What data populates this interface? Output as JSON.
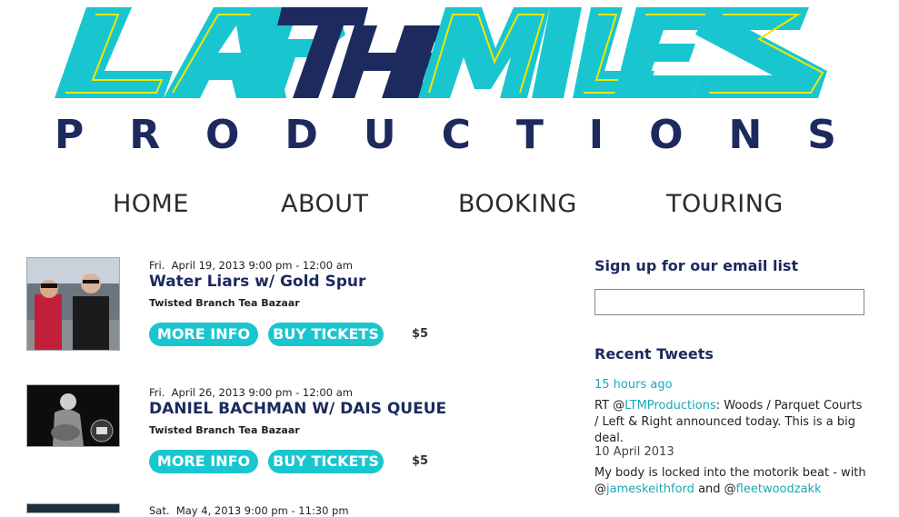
{
  "logo": {
    "art_name": "LAP THE MILES",
    "wordmark_letters": [
      "P",
      "R",
      "O",
      "D",
      "U",
      "C",
      "T",
      "I",
      "O",
      "N",
      "S"
    ]
  },
  "nav": {
    "home": "HOME",
    "about": "ABOUT",
    "booking": "BOOKING",
    "touring": "TOURING"
  },
  "events": [
    {
      "date_prefix": "Fri.",
      "date_rest": "April 19, 2013 9:00 pm - 12:00 am",
      "title": "Water Liars w/ Gold Spur",
      "venue": "Twisted Branch Tea Bazaar",
      "more_info": "MORE INFO",
      "buy": "BUY TICKETS",
      "price": "$5"
    },
    {
      "date_prefix": "Fri.",
      "date_rest": "April 26, 2013 9:00 pm - 12:00 am",
      "title": "DANIEL BACHMAN W/ DAIS QUEUE",
      "venue": "Twisted Branch Tea Bazaar",
      "more_info": "MORE INFO",
      "buy": "BUY TICKETS",
      "price": "$5"
    },
    {
      "date_prefix": "Sat.",
      "date_rest": "May 4, 2013 9:00 pm - 11:30 pm"
    }
  ],
  "sidebar": {
    "email_heading": "Sign up for our email list",
    "email_value": "",
    "tweets_heading": "Recent Tweets",
    "tweets": [
      {
        "time": "15 hours ago",
        "prefix": "RT @",
        "mention": "LTMProductions",
        "text": ": Woods / Parquet Courts / Left & Right announced today. This is a big deal."
      },
      {
        "time": "10 April 2013",
        "text_a": "My body is locked into the motorik beat - with @",
        "mention_a": "jameskeithford",
        "text_b": " and @",
        "mention_b": "fleetwoodzakk"
      }
    ]
  },
  "colors": {
    "teal": "#19c6cf",
    "navy": "#1c2a5e",
    "yellow": "#f2e600",
    "link": "#1aa9b8"
  }
}
